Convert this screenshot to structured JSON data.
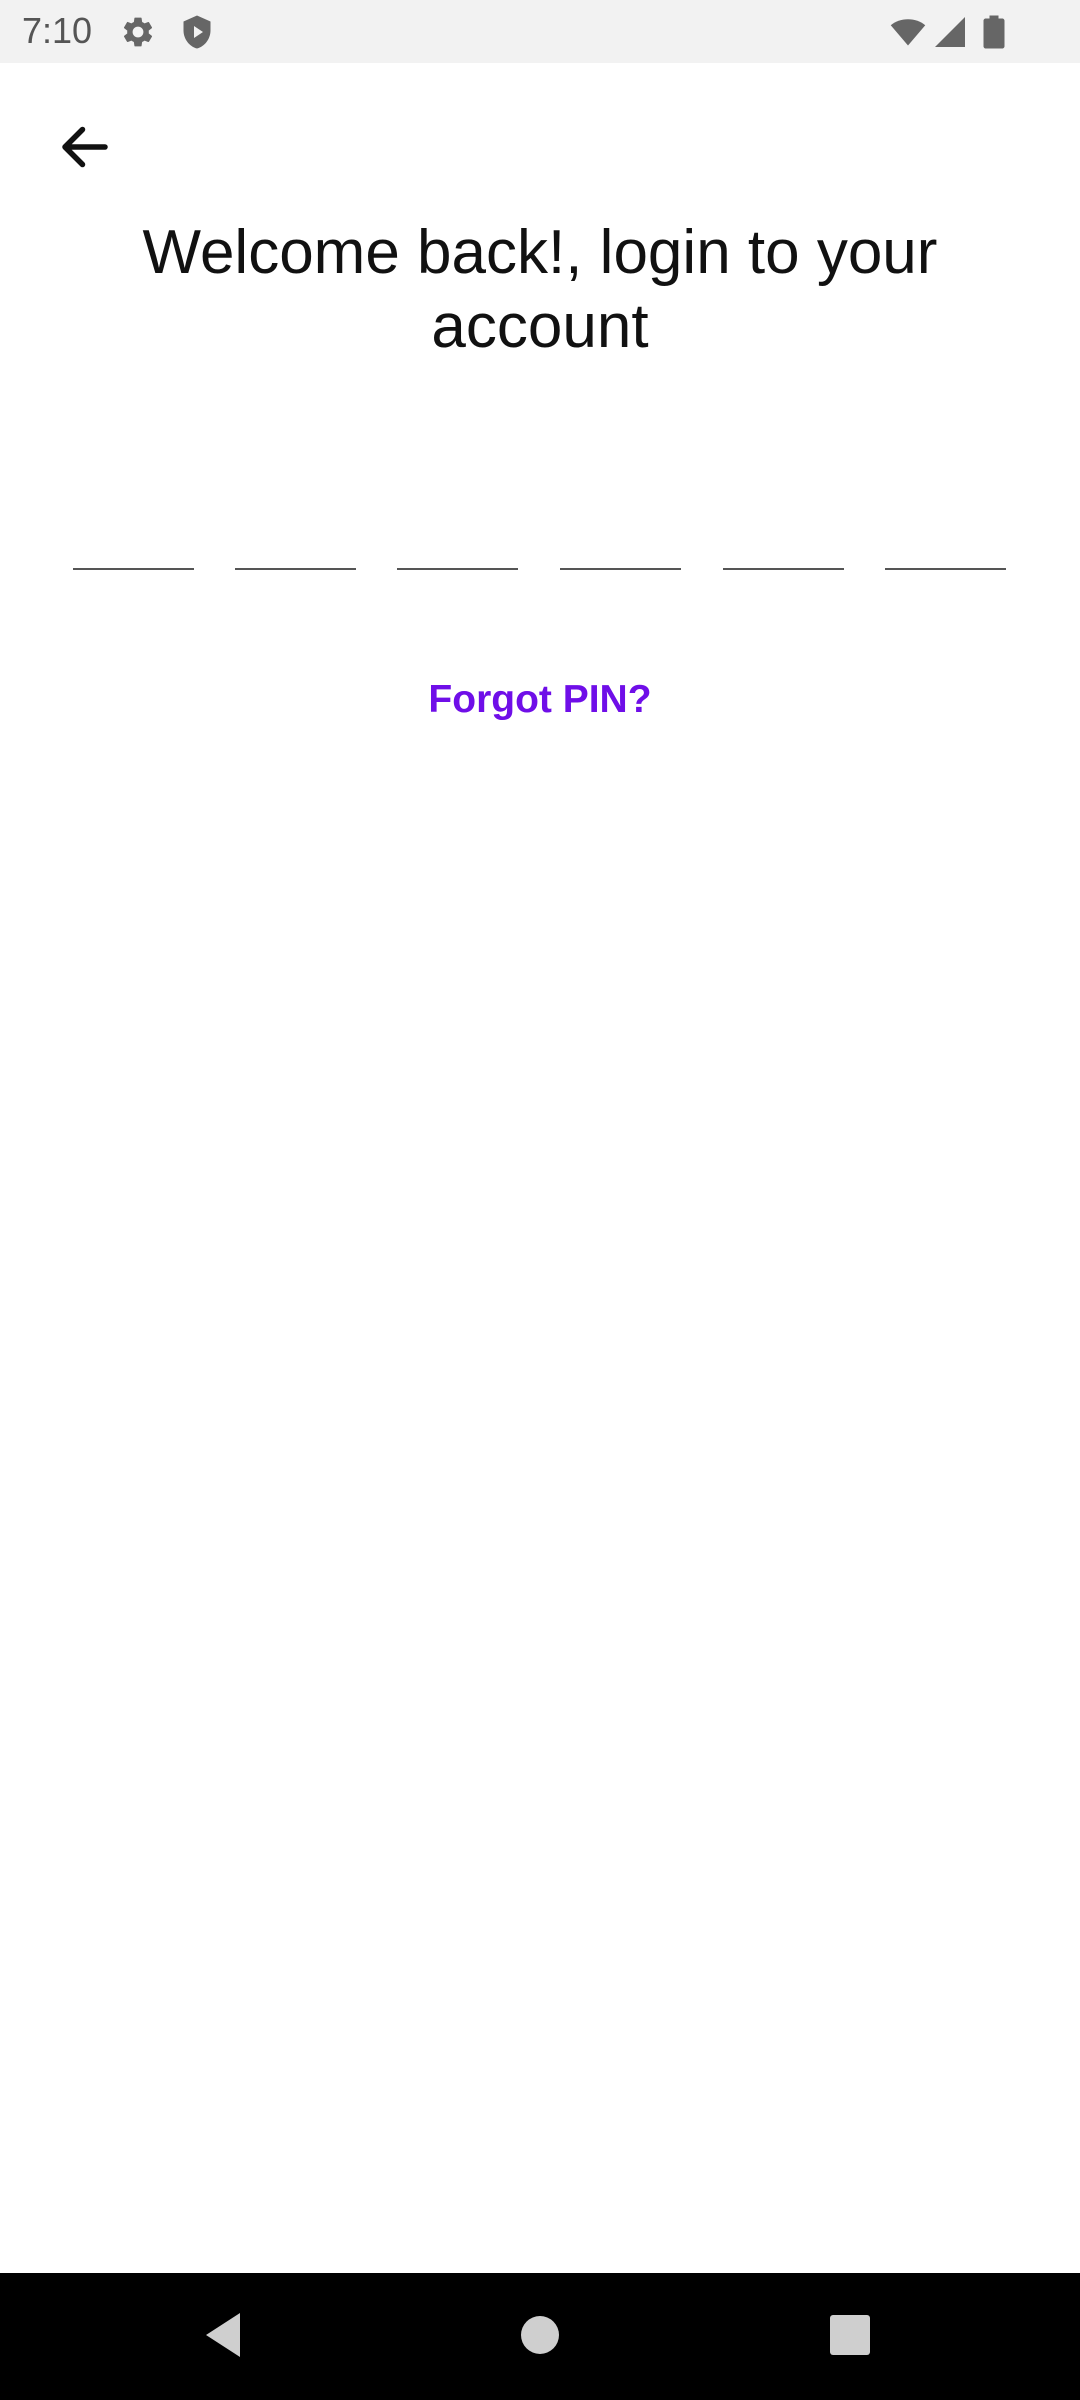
{
  "status_bar": {
    "time": "7:10",
    "left_icons": [
      "gear-icon",
      "shield-icon"
    ],
    "right_icons": [
      "wifi-icon",
      "signal-icon",
      "battery-icon"
    ]
  },
  "header": {
    "back_icon": "arrow-left-icon"
  },
  "main": {
    "title": "Welcome back!, login to your account",
    "pin_length": 6,
    "pin_values": [
      "",
      "",
      "",
      "",
      "",
      ""
    ],
    "forgot_pin_label": "Forgot PIN?"
  },
  "nav_bar": {
    "buttons": [
      "back-triangle-icon",
      "home-circle-icon",
      "recents-square-icon"
    ]
  },
  "colors": {
    "accent": "#6f0ee8",
    "status_bar_bg": "#f2f2f2",
    "nav_bar_bg": "#000000",
    "text": "#111111"
  }
}
